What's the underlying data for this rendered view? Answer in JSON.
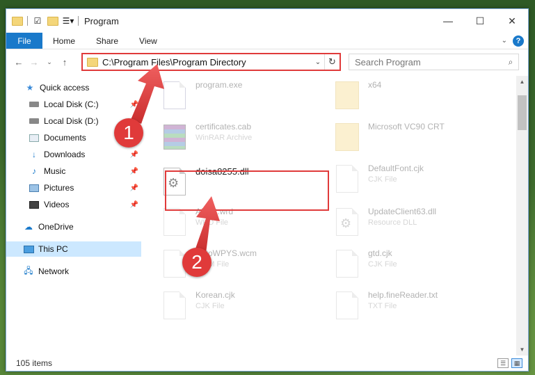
{
  "window": {
    "title": "Program",
    "controls": {
      "minimize": "—",
      "maximize": "☐",
      "close": "✕"
    }
  },
  "ribbon": {
    "file": "File",
    "tabs": [
      "Home",
      "Share",
      "View"
    ]
  },
  "address": {
    "path": "C:\\Program Files\\Program Directory"
  },
  "search": {
    "placeholder": "Search Program"
  },
  "sidebar": {
    "items": [
      {
        "label": "Quick access",
        "icon": "star-icon",
        "pinned": false
      },
      {
        "label": "Local Disk (C:)",
        "icon": "drive-icon",
        "pinned": true
      },
      {
        "label": "Local Disk (D:)",
        "icon": "drive-icon",
        "pinned": false
      },
      {
        "label": "Documents",
        "icon": "documents-icon",
        "pinned": true
      },
      {
        "label": "Downloads",
        "icon": "download-icon",
        "pinned": true
      },
      {
        "label": "Music",
        "icon": "music-icon",
        "pinned": true
      },
      {
        "label": "Pictures",
        "icon": "pictures-icon",
        "pinned": true
      },
      {
        "label": "Videos",
        "icon": "videos-icon",
        "pinned": true
      },
      {
        "label": "OneDrive",
        "icon": "cloud-icon",
        "pinned": false
      },
      {
        "label": "This PC",
        "icon": "pc-icon",
        "pinned": false
      },
      {
        "label": "Network",
        "icon": "network-icon",
        "pinned": false
      }
    ]
  },
  "files": {
    "left": [
      {
        "name": "program.exe",
        "type": ""
      },
      {
        "name": "certificates.cab",
        "type": "WinRAR Archive"
      },
      {
        "name": "doisa8255.dll",
        "type": ""
      },
      {
        "name": "About.wrd",
        "type": "WRD File"
      },
      {
        "name": "AutoWPYS.wcm",
        "type": "WCM File"
      },
      {
        "name": "Korean.cjk",
        "type": "CJK File"
      }
    ],
    "right": [
      {
        "name": "x64",
        "type": ""
      },
      {
        "name": "Microsoft VC90 CRT",
        "type": ""
      },
      {
        "name": "DefaultFont.cjk",
        "type": "CJK File"
      },
      {
        "name": "UpdateClient63.dll",
        "type": "Resource DLL"
      },
      {
        "name": "gtd.cjk",
        "type": "CJK File"
      },
      {
        "name": "help.fineReader.txt",
        "type": "TXT File"
      }
    ]
  },
  "status": {
    "count": "105 items"
  },
  "callouts": {
    "one": "1",
    "two": "2"
  },
  "colors": {
    "accent": "#1979ca",
    "highlight": "#e03a3a",
    "selected": "#cce8ff"
  }
}
